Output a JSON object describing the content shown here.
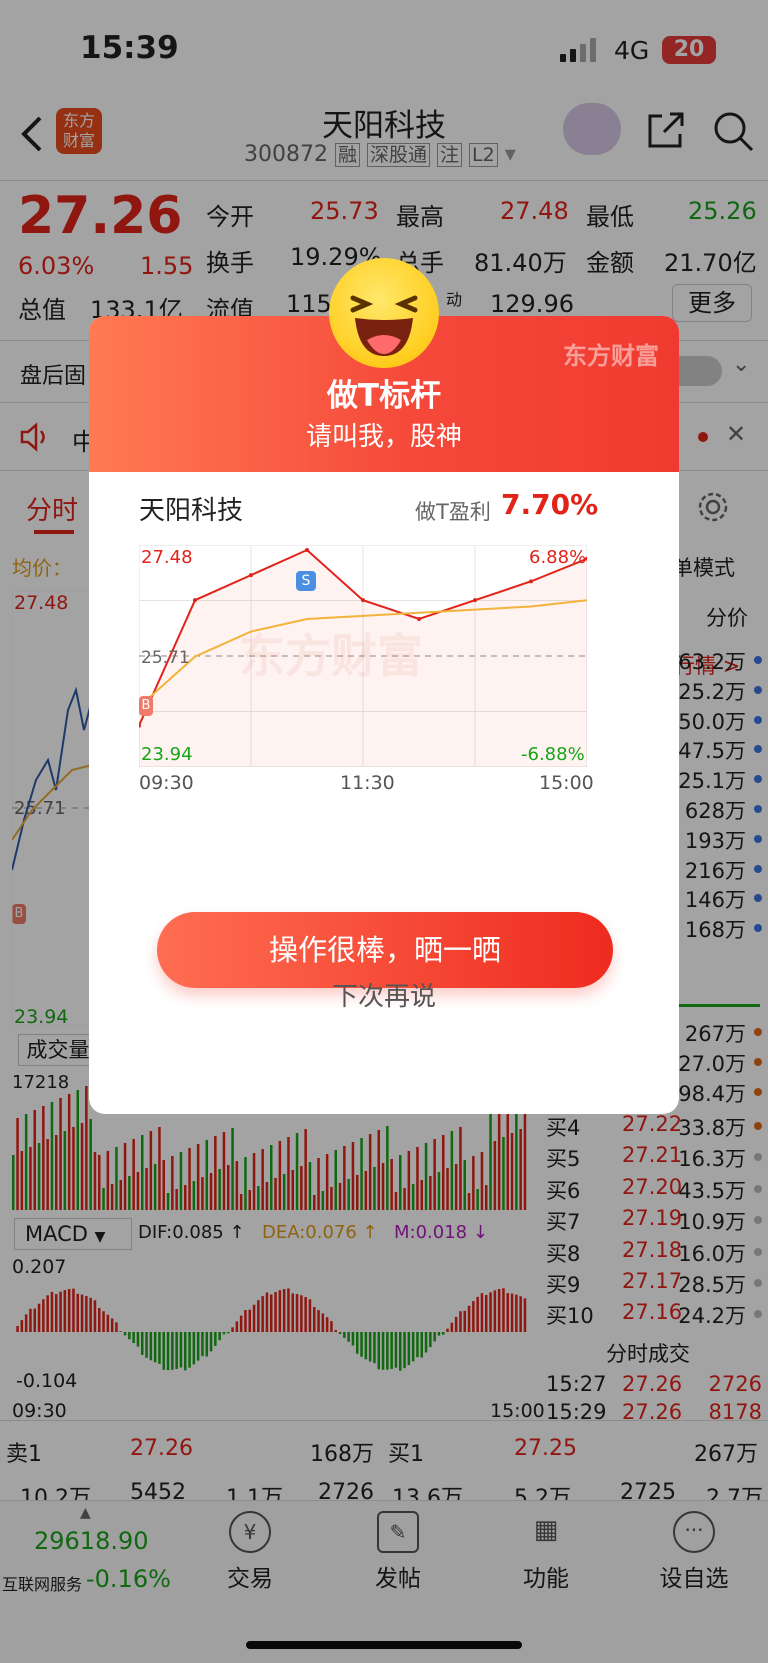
{
  "status": {
    "time": "15:39",
    "network": "4G",
    "battery": "20"
  },
  "header": {
    "title": "天阳科技",
    "code": "300872",
    "tags": [
      "融",
      "深股通",
      "注",
      "L2"
    ]
  },
  "quote": {
    "price": "27.26",
    "pct": "6.03%",
    "change": "1.55",
    "open_label": "今开",
    "open": "25.73",
    "high_label": "最高",
    "high": "27.48",
    "low_label": "最低",
    "low": "25.26",
    "turnover_label": "换手",
    "turnover": "19.29%",
    "volume_label": "总手",
    "volume": "81.40万",
    "amount_label": "金额",
    "amount": "21.70亿",
    "mktcap_label": "总值",
    "mktcap": "133.1亿",
    "float_label": "流值",
    "float": "115.",
    "move_label": "动",
    "move": "129.96",
    "more": "更多"
  },
  "bar1": {
    "label": "盘后固"
  },
  "bar2": {
    "label": "中"
  },
  "tabs": {
    "active": "分时"
  },
  "chart_bg": {
    "avg_label": "均价：",
    "high": "27.48",
    "pre": "25.71",
    "low": "23.94",
    "vol_label": "成交量",
    "vol_max": "17218",
    "macd": "MACD",
    "dif": "DIF:0.085 ↑",
    "dea": "DEA:0.076 ↑",
    "m": "M:0.018 ↓",
    "macd_max": "0.207",
    "macd_min": "-0.104",
    "t_start": "09:30",
    "t_end": "15:00",
    "b_tag": "B"
  },
  "side": {
    "mode": "单模式",
    "fen_jia": "分价",
    "hang_qing": "行情 >",
    "sell_vols": [
      "63.2万",
      "25.2万",
      "50.0万",
      "47.5万",
      "25.1万",
      "628万",
      "193万",
      "216万",
      "146万",
      "168万"
    ],
    "buy_top": [
      "267万",
      "27.0万",
      "98.4万"
    ],
    "buys": [
      {
        "l": "买4",
        "p": "27.22",
        "v": "33.8万"
      },
      {
        "l": "买5",
        "p": "27.21",
        "v": "16.3万"
      },
      {
        "l": "买6",
        "p": "27.20",
        "v": "43.5万"
      },
      {
        "l": "买7",
        "p": "27.19",
        "v": "10.9万"
      },
      {
        "l": "买8",
        "p": "27.18",
        "v": "16.0万"
      },
      {
        "l": "买9",
        "p": "27.17",
        "v": "28.5万"
      },
      {
        "l": "买10",
        "p": "27.16",
        "v": "24.2万"
      }
    ],
    "trades_title": "分时成交",
    "trades": [
      {
        "t": "15:27",
        "p": "27.26",
        "v": "2726"
      },
      {
        "t": "15:29",
        "p": "27.26",
        "v": "8178"
      }
    ]
  },
  "lower": {
    "sell1": "卖1",
    "sell1_p": "27.26",
    "sell1_v": "168万",
    "buy1": "买1",
    "buy1_p": "27.25",
    "buy1_v": "267万",
    "row2": [
      "10.2万",
      "5452",
      "1.1万",
      "2726",
      "13.6万",
      "5.2万",
      "2725",
      "2.7万"
    ]
  },
  "bottom": {
    "index": "29618.90",
    "index_pct": "-0.16%",
    "service": "互联网服务",
    "tabs": [
      "交易",
      "发帖",
      "功能",
      "设自选"
    ]
  },
  "modal": {
    "brand": "东方财富",
    "title": "做T标杆",
    "subtitle": "请叫我，股神",
    "stock": "天阳科技",
    "profit_label": "做T盈利",
    "profit": "7.70%",
    "high": "27.48",
    "low": "23.94",
    "pre": "25.71",
    "pct_high": "6.88%",
    "pct_low": "-6.88%",
    "t1": "09:30",
    "t2": "11:30",
    "t3": "15:00",
    "s_tag": "S",
    "b_tag": "B",
    "watermark": "东方财富",
    "share_btn": "操作很棒，晒一晒",
    "later": "下次再说"
  },
  "chart_data": {
    "type": "line",
    "title": "",
    "xlabel": "",
    "ylabel": "",
    "x": [
      "09:30",
      "10:00",
      "10:30",
      "11:00",
      "11:30",
      "13:30",
      "14:00",
      "14:30",
      "15:00"
    ],
    "series": [
      {
        "values": [
          24.6,
          26.6,
          27.0,
          27.4,
          26.6,
          26.3,
          26.6,
          26.9,
          27.26
        ]
      },
      {
        "values": [
          24.9,
          25.7,
          26.1,
          26.3,
          26.35,
          26.4,
          26.45,
          26.5,
          26.6
        ]
      }
    ],
    "ylim": [
      23.94,
      27.48
    ],
    "reference": 25.71
  }
}
